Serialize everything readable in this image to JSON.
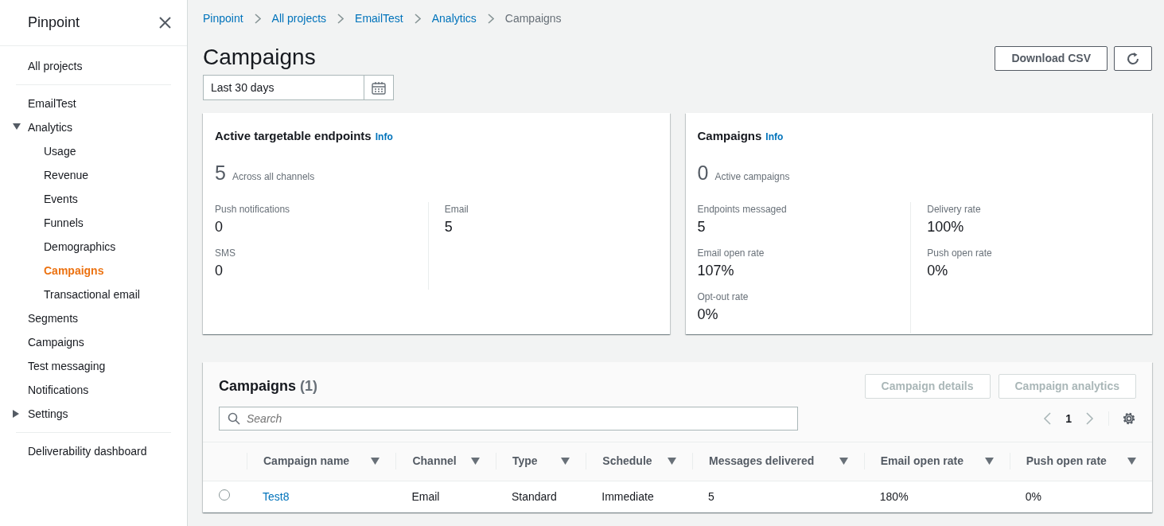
{
  "sidebar": {
    "title": "Pinpoint",
    "groups": [
      [
        {
          "label": "All projects",
          "selected": false
        }
      ],
      [
        {
          "label": "EmailTest",
          "selected": false
        },
        {
          "label": "Analytics",
          "selected": false,
          "expanded": true,
          "children": [
            {
              "label": "Usage",
              "selected": false
            },
            {
              "label": "Revenue",
              "selected": false
            },
            {
              "label": "Events",
              "selected": false
            },
            {
              "label": "Funnels",
              "selected": false
            },
            {
              "label": "Demographics",
              "selected": false
            },
            {
              "label": "Campaigns",
              "selected": true
            },
            {
              "label": "Transactional email",
              "selected": false
            }
          ]
        },
        {
          "label": "Segments",
          "selected": false
        },
        {
          "label": "Campaigns",
          "selected": false
        },
        {
          "label": "Test messaging",
          "selected": false
        },
        {
          "label": "Notifications",
          "selected": false
        },
        {
          "label": "Settings",
          "selected": false,
          "expanded": false
        }
      ],
      [
        {
          "label": "Deliverability dashboard",
          "selected": false
        }
      ]
    ]
  },
  "breadcrumbs": [
    "Pinpoint",
    "All projects",
    "EmailTest",
    "Analytics",
    "Campaigns"
  ],
  "page": {
    "title": "Campaigns",
    "download_button": "Download CSV",
    "date_range": "Last 30 days"
  },
  "cards": [
    {
      "title": "Active targetable endpoints",
      "info": "Info",
      "total": "5",
      "total_label": "Across all channels",
      "columns": [
        [
          {
            "label": "Push notifications",
            "value": "0"
          },
          {
            "label": "SMS",
            "value": "0"
          }
        ],
        [
          {
            "label": "Email",
            "value": "5"
          }
        ]
      ]
    },
    {
      "title": "Campaigns",
      "info": "Info",
      "total": "0",
      "total_label": "Active campaigns",
      "columns": [
        [
          {
            "label": "Endpoints messaged",
            "value": "5"
          },
          {
            "label": "Email open rate",
            "value": "107%"
          },
          {
            "label": "Opt-out rate",
            "value": "0%"
          }
        ],
        [
          {
            "label": "Delivery rate",
            "value": "100%"
          },
          {
            "label": "Push open rate",
            "value": "0%"
          }
        ]
      ]
    }
  ],
  "table": {
    "title": "Campaigns",
    "count": "(1)",
    "buttons": [
      {
        "label": "Campaign details",
        "disabled": true
      },
      {
        "label": "Campaign analytics",
        "disabled": true
      }
    ],
    "search": {
      "placeholder": "Search"
    },
    "page": "1",
    "columns": [
      "Campaign name",
      "Channel",
      "Type",
      "Schedule",
      "Messages delivered",
      "Email open rate",
      "Push open rate"
    ],
    "rows": [
      {
        "selected": false,
        "cells": [
          "Test8",
          "Email",
          "Standard",
          "Immediate",
          "5",
          "180%",
          "0%"
        ]
      }
    ]
  }
}
